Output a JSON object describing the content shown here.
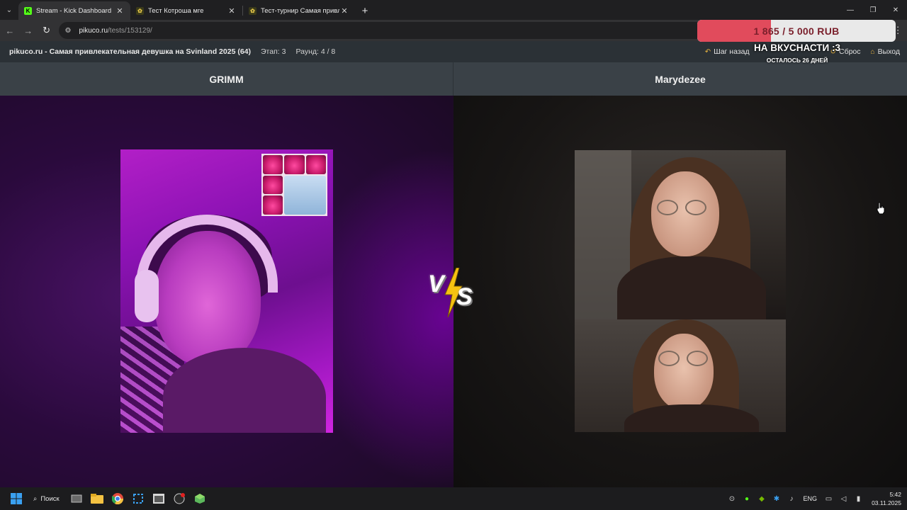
{
  "browser": {
    "tabs": [
      {
        "title": "Stream - Kick Dashboard",
        "favicon": "kick-icon",
        "active": true
      },
      {
        "title": "Тест Котроша мге",
        "favicon": "pikuco-icon",
        "active": false
      },
      {
        "title": "Тест-турнир Самая привлекат",
        "favicon": "pikuco-icon",
        "active": false
      }
    ],
    "new_tab_label": "+",
    "url_host": "pikuco.ru",
    "url_path": "/tests/153129/"
  },
  "site": {
    "title": "pikuco.ru - Самая привлекательная девушка на Svinland 2025 (64)",
    "stage": "Этап: 3",
    "round": "Раунд: 4 / 8",
    "actions": {
      "back": "Шаг назад",
      "reset": "Сброс",
      "exit": "Выход"
    }
  },
  "donation_goal": {
    "amount_text": "1 865 / 5 000 RUB",
    "progress": 0.373,
    "title": "НА ВКУСНАСТИ :3",
    "subtitle": "ОСТАЛОСЬ 26 ДНЕЙ",
    "fill_color": "#e14b5c"
  },
  "contestants": {
    "left": {
      "name": "GRIMM"
    },
    "right": {
      "name": "Marydezee"
    }
  },
  "vs_label": {
    "v": "V",
    "s": "S"
  },
  "taskbar": {
    "search_label": "Поиск",
    "lang": "ENG",
    "time": "5:42",
    "date": "03.11.2025"
  }
}
